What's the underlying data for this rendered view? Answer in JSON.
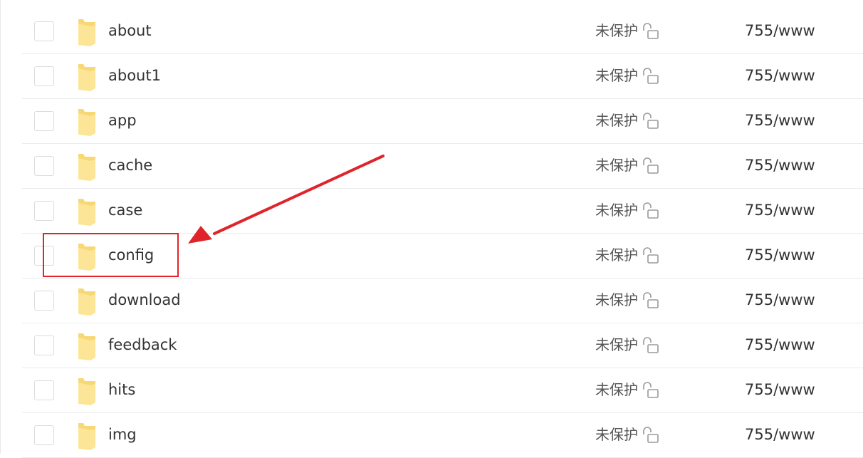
{
  "files": [
    {
      "name": "about",
      "protection": "未保护",
      "permission": "755/www"
    },
    {
      "name": "about1",
      "protection": "未保护",
      "permission": "755/www"
    },
    {
      "name": "app",
      "protection": "未保护",
      "permission": "755/www"
    },
    {
      "name": "cache",
      "protection": "未保护",
      "permission": "755/www"
    },
    {
      "name": "case",
      "protection": "未保护",
      "permission": "755/www"
    },
    {
      "name": "config",
      "protection": "未保护",
      "permission": "755/www"
    },
    {
      "name": "download",
      "protection": "未保护",
      "permission": "755/www"
    },
    {
      "name": "feedback",
      "protection": "未保护",
      "permission": "755/www"
    },
    {
      "name": "hits",
      "protection": "未保护",
      "permission": "755/www"
    },
    {
      "name": "img",
      "protection": "未保护",
      "permission": "755/www"
    }
  ],
  "highlighted_item": "config",
  "colors": {
    "folder_body": "#f8d775",
    "folder_front": "#fde597",
    "annotation": "#e0242b",
    "lock_icon": "#9a9a9a"
  },
  "icons": {
    "folder": "folder-icon",
    "lock": "unlocked-padlock-icon"
  }
}
